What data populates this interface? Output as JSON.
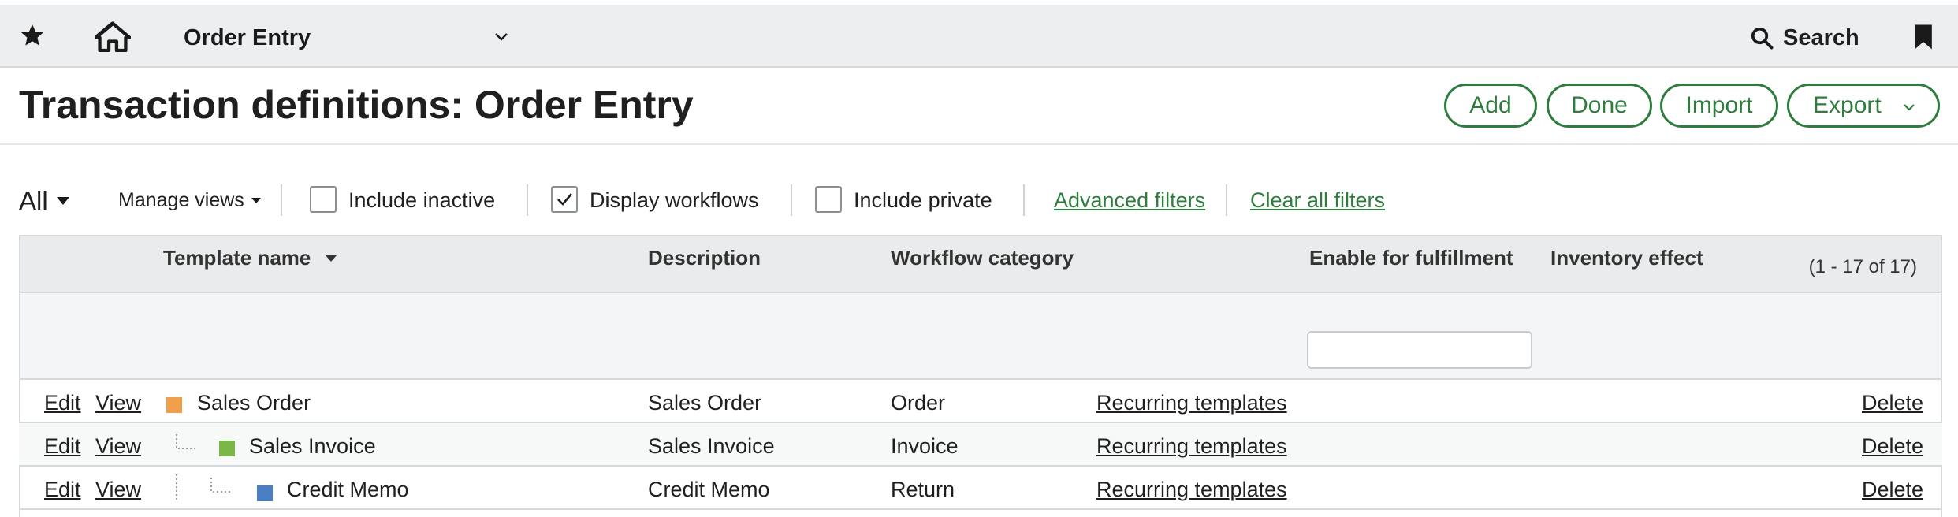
{
  "topbar": {
    "favorite_icon": "star-icon",
    "home_icon": "home-icon",
    "app_title": "Order Entry",
    "app_menu_icon": "chevron-down-icon",
    "search_label": "Search",
    "search_icon": "search-icon",
    "bookmark_icon": "bookmark-icon"
  },
  "header": {
    "title": "Transaction definitions: Order Entry",
    "buttons": {
      "add": "Add",
      "done": "Done",
      "import": "Import",
      "export": "Export"
    }
  },
  "filters": {
    "view": "All",
    "manage_views": "Manage views",
    "include_inactive": {
      "label": "Include inactive",
      "checked": false
    },
    "display_workflows": {
      "label": "Display workflows",
      "checked": true
    },
    "include_private": {
      "label": "Include private",
      "checked": false
    },
    "advanced_filters": "Advanced filters",
    "clear_all_filters": "Clear all filters"
  },
  "table": {
    "count": "(1 - 17 of 17)",
    "columns": {
      "template_name": "Template name",
      "description": "Description",
      "workflow_category": "Workflow category",
      "enable_for_fulfillment": "Enable for fulfillment",
      "inventory_effect": "Inventory effect"
    },
    "fulfillment_filter_value": "",
    "rows": [
      {
        "edit": "Edit",
        "view": "View",
        "name": "Sales Order",
        "color": "#f0a04b",
        "description": "Sales Order",
        "category": "Order",
        "recurring": "Recurring templates",
        "delete": "Delete"
      },
      {
        "edit": "Edit",
        "view": "View",
        "name": "Sales Invoice",
        "color": "#7ab648",
        "description": "Sales Invoice",
        "category": "Invoice",
        "recurring": "Recurring templates",
        "delete": "Delete"
      },
      {
        "edit": "Edit",
        "view": "View",
        "name": "Credit Memo",
        "color": "#4a7fc1",
        "description": "Credit Memo",
        "category": "Return",
        "recurring": "Recurring templates",
        "delete": "Delete"
      }
    ]
  },
  "colors": {
    "accent": "#2e7d3e",
    "topbar_bg": "#eceeef"
  }
}
